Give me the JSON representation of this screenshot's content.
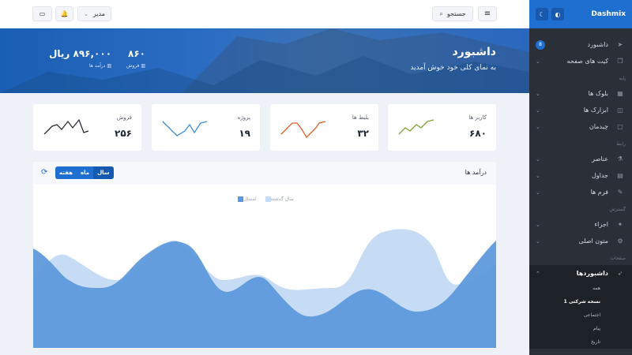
{
  "sidebar": {
    "brand": "Dashmix",
    "items": [
      {
        "label": "داشبورد",
        "badge": "8"
      },
      {
        "label": "کیت های صفحه"
      }
    ],
    "sections": [
      {
        "title": "پایه",
        "items": [
          {
            "label": "بلوک ها"
          },
          {
            "label": "ابزارک ها"
          },
          {
            "label": "چیدمان"
          }
        ]
      },
      {
        "title": "رابط",
        "items": [
          {
            "label": "عناصر"
          },
          {
            "label": "جداول"
          },
          {
            "label": "فرم ها"
          }
        ]
      },
      {
        "title": "گسترش",
        "items": [
          {
            "label": "اجزاء"
          },
          {
            "label": "متون اصلی"
          }
        ]
      },
      {
        "title": "صفحات",
        "items": [
          {
            "label": "داشبوردها"
          }
        ]
      }
    ],
    "submenu": [
      "همه",
      "نسخه شرکتی 1",
      "اجتماعی",
      "پیام",
      "تاریخ"
    ]
  },
  "topbar": {
    "search_label": "جستجو",
    "user_label": "مدیر"
  },
  "hero": {
    "title": "داشبورد",
    "subtitle": "به نمای کلی خود خوش آمدید",
    "stats": [
      {
        "value": "۸۶۰",
        "label": "فروش"
      },
      {
        "value": "۸۹۶,۰۰۰ ریال",
        "label": "درآمد ها"
      }
    ]
  },
  "cards": [
    {
      "label": "کاربر ها",
      "value": "۶۸۰",
      "color": "#7fa23a"
    },
    {
      "label": "بلیط ها",
      "value": "۳۲",
      "color": "#e0612b"
    },
    {
      "label": "پروژه",
      "value": "۱۹",
      "color": "#3b8fd8"
    },
    {
      "label": "فروش",
      "value": "۲۵۶",
      "color": "#2b2f36"
    }
  ],
  "panel": {
    "title": "درآمد ها",
    "segments": [
      "هفته",
      "ماه",
      "سال"
    ],
    "active_segment": "سال"
  },
  "chart_data": {
    "type": "area",
    "series": [
      {
        "name": "امسال",
        "color": "#5b98dc"
      },
      {
        "name": "سال گذشته",
        "color": "#c6dbf4"
      }
    ]
  }
}
